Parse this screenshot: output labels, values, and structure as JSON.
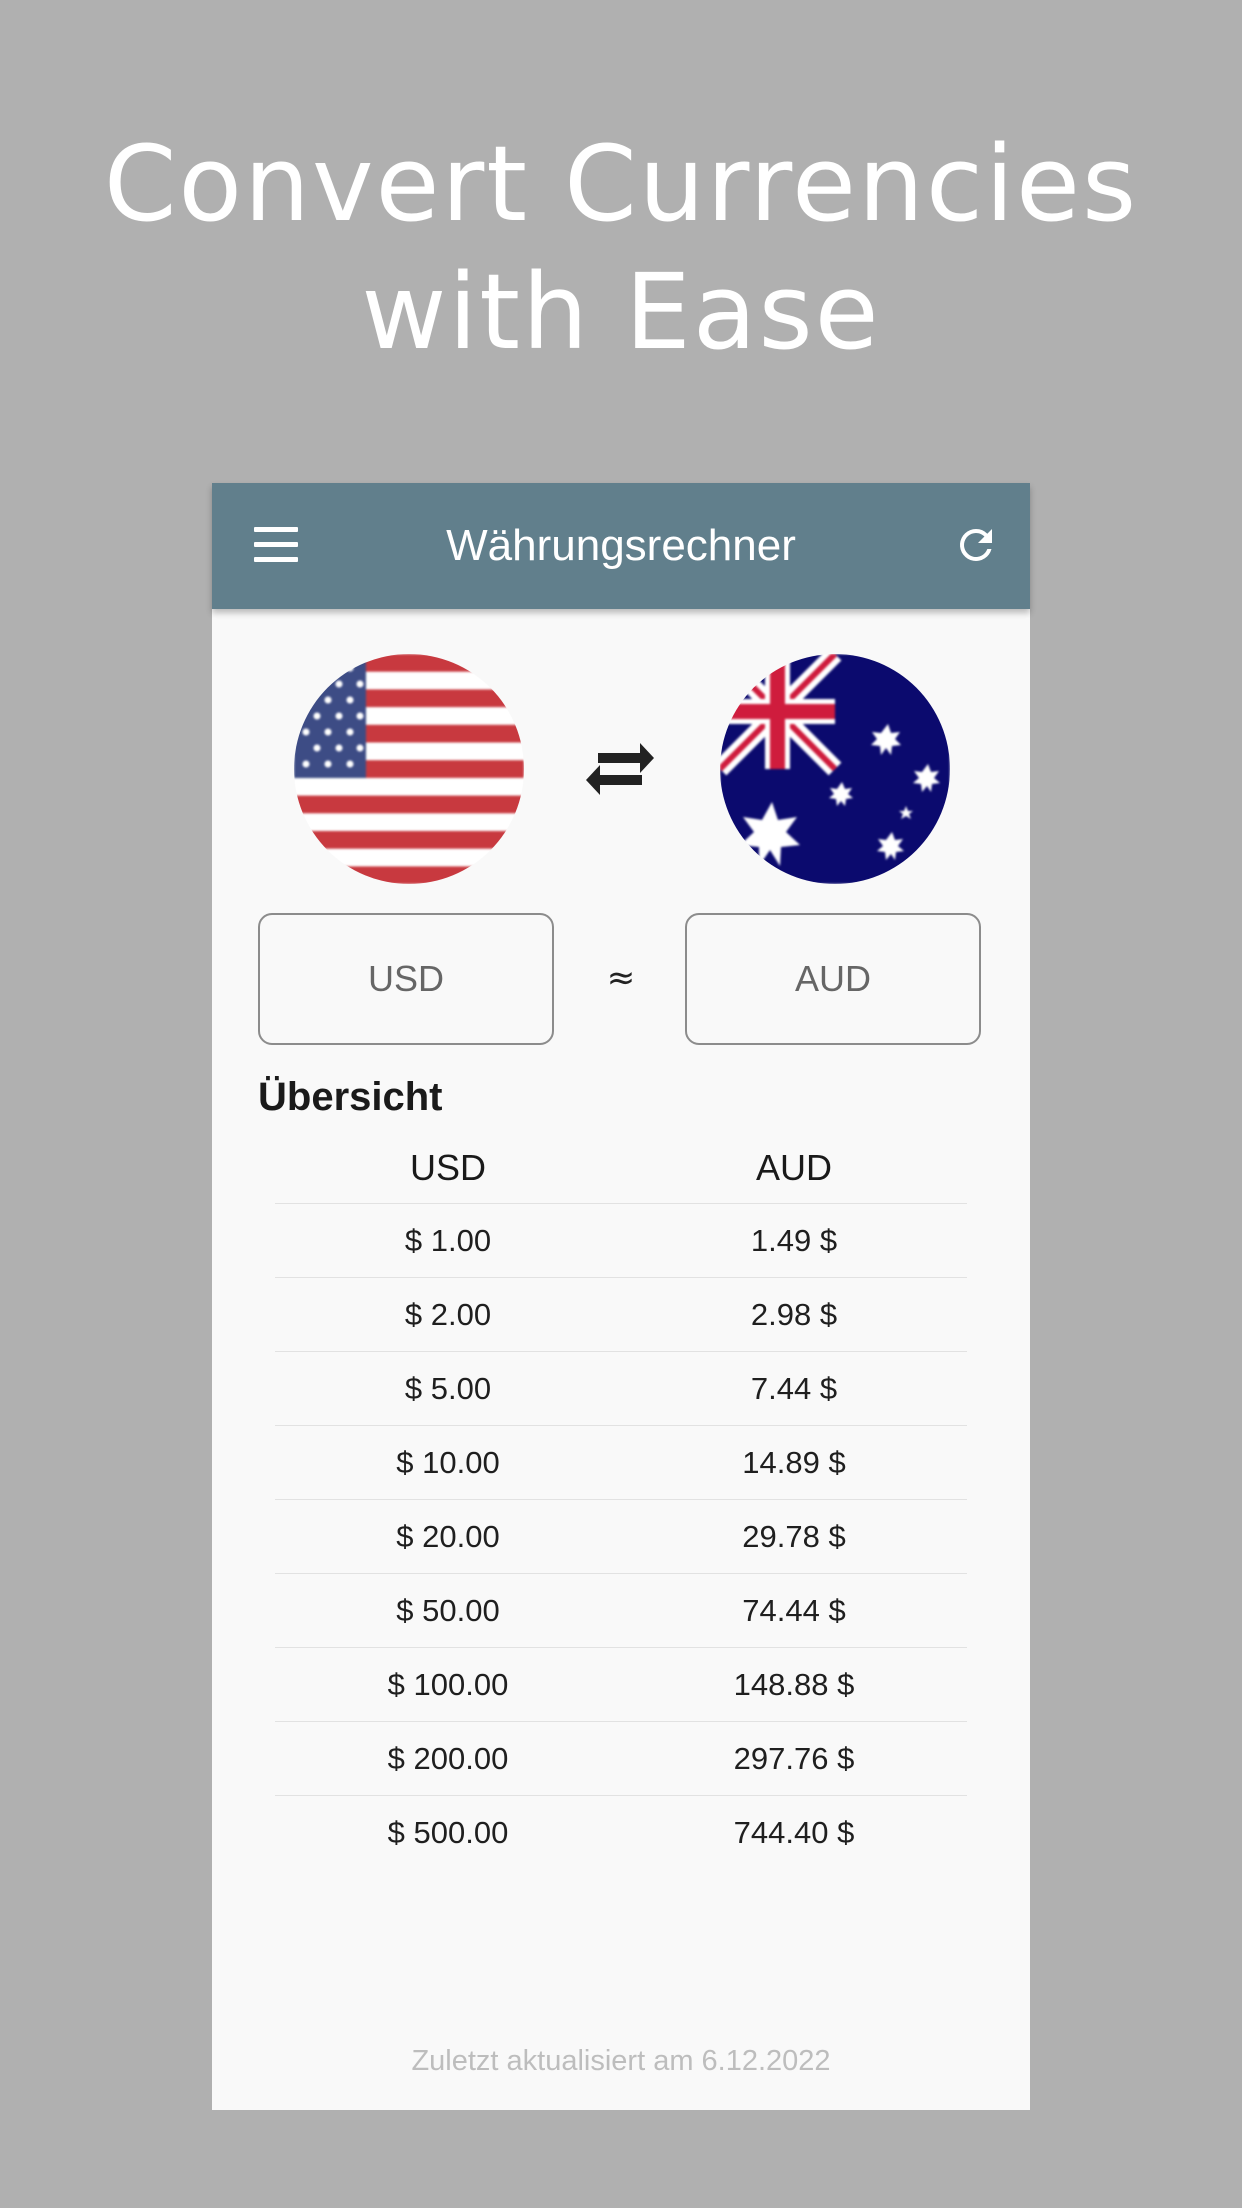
{
  "headline": {
    "line1": "Convert Currencies",
    "line2": "with Ease"
  },
  "appbar": {
    "title": "Währungsrechner",
    "menu_icon": "menu-icon",
    "refresh_icon": "refresh-icon",
    "color": "#617f8c"
  },
  "converter": {
    "from_flag": "us-flag-icon",
    "to_flag": "australia-flag-icon",
    "swap_icon": "swap-arrows-icon",
    "from_code": "USD",
    "to_code": "AUD",
    "approx_symbol": "≈"
  },
  "overview": {
    "title": "Übersicht",
    "columns": [
      "USD",
      "AUD"
    ],
    "rows": [
      [
        "$ 1.00",
        "1.49 $"
      ],
      [
        "$ 2.00",
        "2.98 $"
      ],
      [
        "$ 5.00",
        "7.44 $"
      ],
      [
        "$ 10.00",
        "14.89 $"
      ],
      [
        "$ 20.00",
        "29.78 $"
      ],
      [
        "$ 50.00",
        "74.44 $"
      ],
      [
        "$ 100.00",
        "148.88 $"
      ],
      [
        "$ 200.00",
        "297.76 $"
      ],
      [
        "$ 500.00",
        "744.40 $"
      ]
    ]
  },
  "footer": {
    "last_updated": "Zuletzt aktualisiert am 6.12.2022"
  }
}
